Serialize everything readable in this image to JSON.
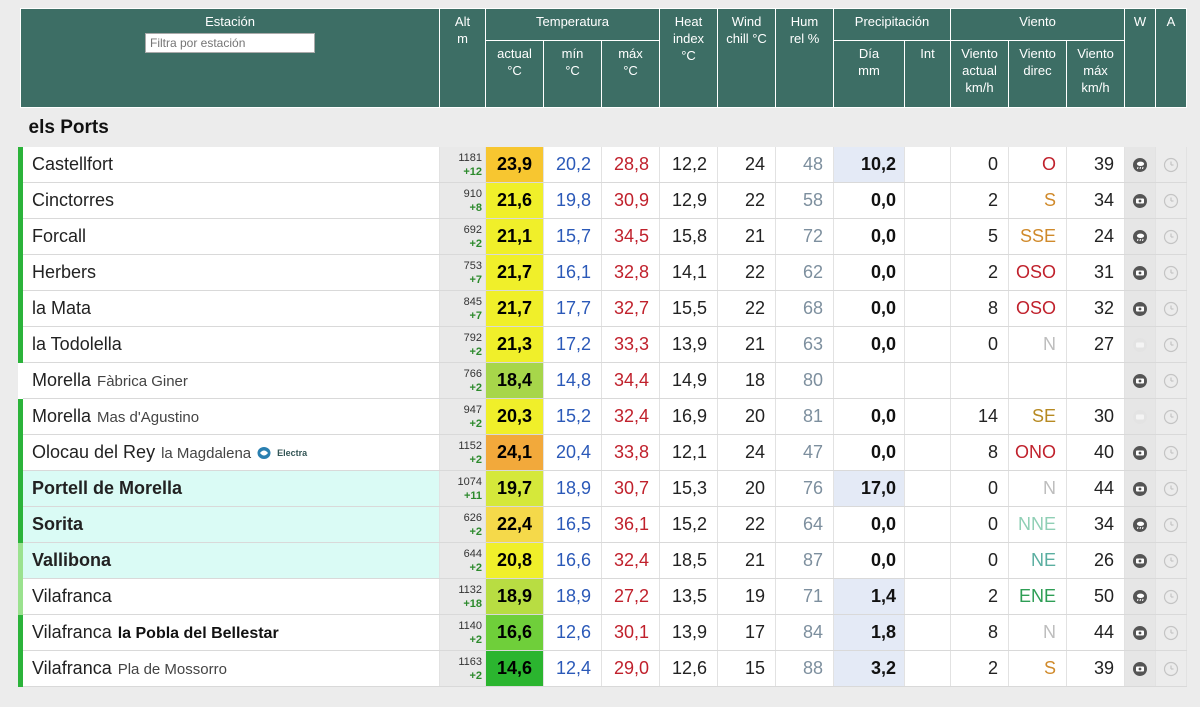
{
  "header": {
    "estacion": "Estación",
    "filter_placeholder": "Filtra por estación",
    "alt": "Alt m",
    "temperatura": "Temperatura",
    "heat_index": "Heat index °C",
    "wind_chill": "Wind chill °C",
    "hum_rel": "Hum rel %",
    "precipitacion": "Precipitación",
    "viento": "Viento",
    "w": "W",
    "a": "A",
    "t_actual": "actual °C",
    "t_min": "mín °C",
    "t_max": "máx °C",
    "p_dia": "Día mm",
    "p_int": "Int",
    "v_actual": "Viento actual km/h",
    "v_direc": "Viento direc",
    "v_max": "Viento máx km/h"
  },
  "group_title": "els Ports",
  "colors": {
    "header_bg": "#3d6e65",
    "wind_dir_red": "#c0212c",
    "wind_dir_orange": "#d08a2b",
    "wind_dir_green": "#2e9e55",
    "wind_dir_teal": "#5aaea0",
    "wind_dir_grey": "#bdbdbd"
  },
  "stations": [
    {
      "name": "Castellfort",
      "sub": "",
      "alt": "1181",
      "alt_delta": "+12",
      "t_act": "23,9",
      "t_act_color": "#f7c630",
      "t_min": "20,2",
      "t_max": "28,8",
      "heat": "12,2",
      "chill": "24",
      "hum": "48",
      "p_day": "10,2",
      "p_int": "",
      "w_act": "0",
      "w_dir": "O",
      "w_dir_color": "#c0212c",
      "w_max": "39",
      "icon_w": "rain-cloud-icon",
      "bar": "strong",
      "bold": false,
      "hl": false
    },
    {
      "name": "Cinctorres",
      "sub": "",
      "alt": "910",
      "alt_delta": "+8",
      "t_act": "21,6",
      "t_act_color": "#f0ef2a",
      "t_min": "19,8",
      "t_max": "30,9",
      "heat": "12,9",
      "chill": "22",
      "hum": "58",
      "p_day": "0,0",
      "p_int": "",
      "w_act": "2",
      "w_dir": "S",
      "w_dir_color": "#d08a2b",
      "w_max": "34",
      "icon_w": "webcam-icon",
      "bar": "strong",
      "bold": false,
      "hl": false
    },
    {
      "name": "Forcall",
      "sub": "",
      "alt": "692",
      "alt_delta": "+2",
      "t_act": "21,1",
      "t_act_color": "#f0ef2a",
      "t_min": "15,7",
      "t_max": "34,5",
      "heat": "15,8",
      "chill": "21",
      "hum": "72",
      "p_day": "0,0",
      "p_int": "",
      "w_act": "5",
      "w_dir": "SSE",
      "w_dir_color": "#d08a2b",
      "w_max": "24",
      "icon_w": "rain-cloud-icon",
      "bar": "strong",
      "bold": false,
      "hl": false
    },
    {
      "name": "Herbers",
      "sub": "",
      "alt": "753",
      "alt_delta": "+7",
      "t_act": "21,7",
      "t_act_color": "#f0ef2a",
      "t_min": "16,1",
      "t_max": "32,8",
      "heat": "14,1",
      "chill": "22",
      "hum": "62",
      "p_day": "0,0",
      "p_int": "",
      "w_act": "2",
      "w_dir": "OSO",
      "w_dir_color": "#c0212c",
      "w_max": "31",
      "icon_w": "webcam-icon",
      "bar": "strong",
      "bold": false,
      "hl": false
    },
    {
      "name": "la Mata",
      "sub": "",
      "alt": "845",
      "alt_delta": "+7",
      "t_act": "21,7",
      "t_act_color": "#f0ef2a",
      "t_min": "17,7",
      "t_max": "32,7",
      "heat": "15,5",
      "chill": "22",
      "hum": "68",
      "p_day": "0,0",
      "p_int": "",
      "w_act": "8",
      "w_dir": "OSO",
      "w_dir_color": "#c0212c",
      "w_max": "32",
      "icon_w": "webcam-icon",
      "bar": "strong",
      "bold": false,
      "hl": false
    },
    {
      "name": "la Todolella",
      "sub": "",
      "alt": "792",
      "alt_delta": "+2",
      "t_act": "21,3",
      "t_act_color": "#f0ef2a",
      "t_min": "17,2",
      "t_max": "33,3",
      "heat": "13,9",
      "chill": "21",
      "hum": "63",
      "p_day": "0,0",
      "p_int": "",
      "w_act": "0",
      "w_dir": "N",
      "w_dir_color": "#bdbdbd",
      "w_max": "27",
      "icon_w": "webcam-off-icon",
      "bar": "strong",
      "bold": false,
      "hl": false
    },
    {
      "name": "Morella",
      "sub": "Fàbrica Giner",
      "alt": "766",
      "alt_delta": "+2",
      "t_act": "18,4",
      "t_act_color": "#a7d64a",
      "t_min": "14,8",
      "t_max": "34,4",
      "heat": "14,9",
      "chill": "18",
      "hum": "80",
      "p_day": "",
      "p_int": "",
      "w_act": "",
      "w_dir": "",
      "w_dir_color": "#bdbdbd",
      "w_max": "",
      "icon_w": "webcam-icon",
      "bar": "none",
      "bold": false,
      "hl": false
    },
    {
      "name": "Morella",
      "sub": "Mas d'Agustino",
      "alt": "947",
      "alt_delta": "+2",
      "t_act": "20,3",
      "t_act_color": "#f0ef2a",
      "t_min": "15,2",
      "t_max": "32,4",
      "heat": "16,9",
      "chill": "20",
      "hum": "81",
      "p_day": "0,0",
      "p_int": "",
      "w_act": "14",
      "w_dir": "SE",
      "w_dir_color": "#b78a22",
      "w_max": "30",
      "icon_w": "webcam-off-icon",
      "bar": "strong",
      "bold": false,
      "hl": false
    },
    {
      "name": "Olocau del Rey",
      "sub": "la Magdalena",
      "alt": "1152",
      "alt_delta": "+2",
      "t_act": "24,1",
      "t_act_color": "#f2a93b",
      "t_min": "20,4",
      "t_max": "33,8",
      "heat": "12,1",
      "chill": "24",
      "hum": "47",
      "p_day": "0,0",
      "p_int": "",
      "w_act": "8",
      "w_dir": "ONO",
      "w_dir_color": "#c0212c",
      "w_max": "40",
      "icon_w": "webcam-icon",
      "bar": "strong",
      "bold": false,
      "hl": false,
      "logo": "Electra"
    },
    {
      "name": "Portell de Morella",
      "sub": "",
      "alt": "1074",
      "alt_delta": "+11",
      "t_act": "19,7",
      "t_act_color": "#d5e83a",
      "t_min": "18,9",
      "t_max": "30,7",
      "heat": "15,3",
      "chill": "20",
      "hum": "76",
      "p_day": "17,0",
      "p_int": "",
      "w_act": "0",
      "w_dir": "N",
      "w_dir_color": "#bdbdbd",
      "w_max": "44",
      "icon_w": "webcam-icon",
      "bar": "strong",
      "bold": true,
      "hl": true
    },
    {
      "name": "Sorita",
      "sub": "",
      "alt": "626",
      "alt_delta": "+2",
      "t_act": "22,4",
      "t_act_color": "#f5d94a",
      "t_min": "16,5",
      "t_max": "36,1",
      "heat": "15,2",
      "chill": "22",
      "hum": "64",
      "p_day": "0,0",
      "p_int": "",
      "w_act": "0",
      "w_dir": "NNE",
      "w_dir_color": "#8fcfb5",
      "w_max": "34",
      "icon_w": "rain-cloud-icon",
      "bar": "strong",
      "bold": true,
      "hl": true
    },
    {
      "name": "Vallibona",
      "sub": "",
      "alt": "644",
      "alt_delta": "+2",
      "t_act": "20,8",
      "t_act_color": "#f0ef2a",
      "t_min": "16,6",
      "t_max": "32,4",
      "heat": "18,5",
      "chill": "21",
      "hum": "87",
      "p_day": "0,0",
      "p_int": "",
      "w_act": "0",
      "w_dir": "NE",
      "w_dir_color": "#5aaea0",
      "w_max": "26",
      "icon_w": "webcam-icon",
      "bar": "light",
      "bold": true,
      "hl": true
    },
    {
      "name": "Vilafranca",
      "sub": "",
      "alt": "1132",
      "alt_delta": "+18",
      "t_act": "18,9",
      "t_act_color": "#b8dd42",
      "t_min": "18,9",
      "t_max": "27,2",
      "heat": "13,5",
      "chill": "19",
      "hum": "71",
      "p_day": "1,4",
      "p_int": "",
      "w_act": "2",
      "w_dir": "ENE",
      "w_dir_color": "#2e9e55",
      "w_max": "50",
      "icon_w": "rain-cloud-icon",
      "bar": "light",
      "bold": false,
      "hl": false
    },
    {
      "name": "Vilafranca",
      "sub": "la Pobla del Bellestar",
      "sub_bold": true,
      "alt": "1140",
      "alt_delta": "+2",
      "t_act": "16,6",
      "t_act_color": "#6fcf3a",
      "t_min": "12,6",
      "t_max": "30,1",
      "heat": "13,9",
      "chill": "17",
      "hum": "84",
      "p_day": "1,8",
      "p_int": "",
      "w_act": "8",
      "w_dir": "N",
      "w_dir_color": "#bdbdbd",
      "w_max": "44",
      "icon_w": "webcam-icon",
      "bar": "strong",
      "bold": false,
      "hl": false
    },
    {
      "name": "Vilafranca",
      "sub": "Pla de Mossorro",
      "alt": "1163",
      "alt_delta": "+2",
      "t_act": "14,6",
      "t_act_color": "#2bb52f",
      "t_min": "12,4",
      "t_max": "29,0",
      "heat": "12,6",
      "chill": "15",
      "hum": "88",
      "p_day": "3,2",
      "p_int": "",
      "w_act": "2",
      "w_dir": "S",
      "w_dir_color": "#d08a2b",
      "w_max": "39",
      "icon_w": "webcam-icon",
      "bar": "strong",
      "bold": false,
      "hl": false
    }
  ]
}
